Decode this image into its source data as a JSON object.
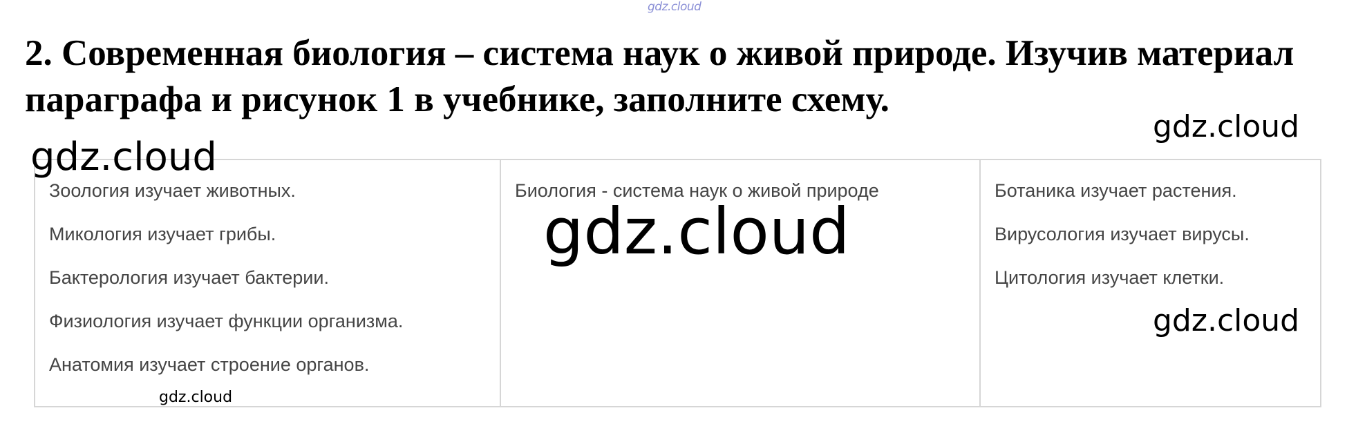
{
  "watermark_top": "gdz.cloud",
  "title": "2. Современная биология – система наук о живой природе. Изучив материал параграфа и рисунок 1 в учебнике, заполните схему.",
  "watermarks": [
    "gdz.cloud",
    "gdz.cloud",
    "gdz.cloud",
    "gdz.cloud",
    "gdz.cloud"
  ],
  "scheme": {
    "left": [
      "Зоология изучает животных.",
      "Микология изучает грибы.",
      "Бактерология изучает бактерии.",
      "Физиология изучает функции организма.",
      "Анатомия изучает строение органов."
    ],
    "center": "Биология - система наук о живой природе",
    "right": [
      "Ботаника изучает растения.",
      "Вирусология изучает вирусы.",
      "Цитология изучает клетки."
    ]
  }
}
